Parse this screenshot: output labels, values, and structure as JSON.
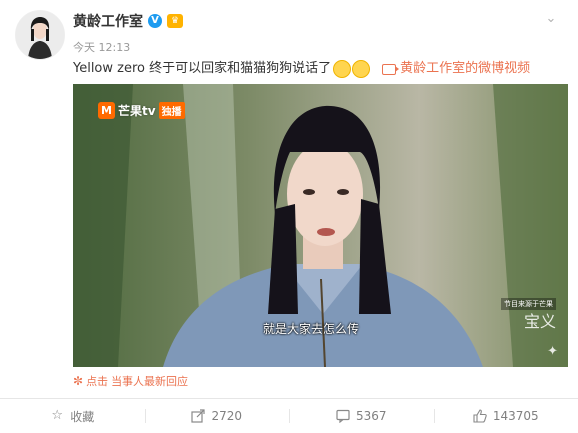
{
  "post": {
    "username": "黄龄工作室",
    "verified_badge": "V",
    "member_badge": "会员",
    "time": "今天 12:13",
    "text": "Yellow zero 终于可以回家和猫猫狗狗说话了",
    "video_link": "黄龄工作室的微博视频",
    "more_icon": "chevron-down-icon"
  },
  "video": {
    "logo_text": "芒果tv",
    "logo_exclusive": "独播",
    "subtitle": "就是大家去怎么传",
    "watermark_small": "节目来源于芒果",
    "watermark_script": "宝义",
    "colors": {
      "background": "#556b46",
      "hair": "#15121a",
      "shirt": "#7f98b8"
    }
  },
  "respond": {
    "label": "点击",
    "link": "当事人最新回应"
  },
  "actions": [
    {
      "icon": "star-icon",
      "label": "收藏"
    },
    {
      "icon": "share-icon",
      "label": "2720"
    },
    {
      "icon": "comment-icon",
      "label": "5367"
    },
    {
      "icon": "thumbs-up-icon",
      "label": "143705"
    }
  ],
  "colors": {
    "accent": "#eb7350",
    "text": "#333333",
    "muted": "#999999",
    "divider": "#e6e6e6"
  }
}
